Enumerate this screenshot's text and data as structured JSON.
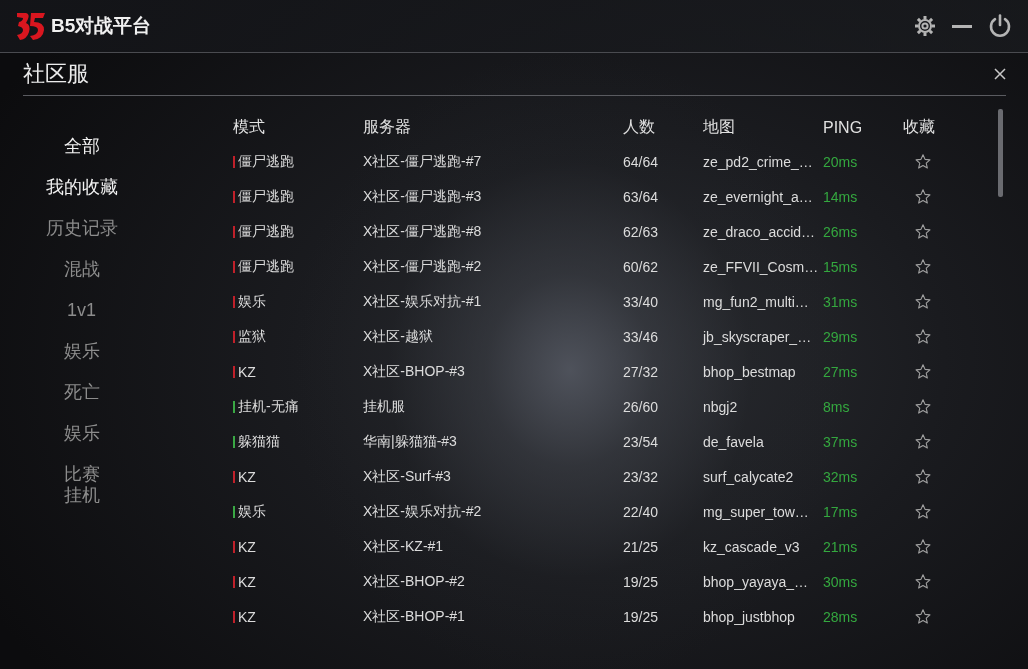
{
  "app": {
    "logo_text": "B5对战平台"
  },
  "panel": {
    "title": "社区服"
  },
  "sidebar": {
    "items": [
      {
        "label": "全部",
        "selected": true
      },
      {
        "label": "我的收藏",
        "selected": true
      },
      {
        "label": "历史记录",
        "selected": false
      },
      {
        "label": "混战",
        "selected": false
      },
      {
        "label": "1v1",
        "selected": false
      },
      {
        "label": "娱乐",
        "selected": false
      },
      {
        "label": "死亡",
        "selected": false
      },
      {
        "label": "娱乐",
        "selected": false
      },
      {
        "label": "比赛挂机",
        "selected": false
      }
    ]
  },
  "table": {
    "columns": [
      "模式",
      "服务器",
      "人数",
      "地图",
      "PING",
      "收藏"
    ],
    "rows": [
      {
        "mode": "僵尸逃跑",
        "color": "#c0202a",
        "server": "X社区-僵尸逃跑-#7",
        "players": "64/64",
        "map": "ze_pd2_crime_…",
        "ping": "20ms",
        "favorited": false
      },
      {
        "mode": "僵尸逃跑",
        "color": "#c0202a",
        "server": "X社区-僵尸逃跑-#3",
        "players": "63/64",
        "map": "ze_evernight_a…",
        "ping": "14ms",
        "favorited": false
      },
      {
        "mode": "僵尸逃跑",
        "color": "#c0202a",
        "server": "X社区-僵尸逃跑-#8",
        "players": "62/63",
        "map": "ze_draco_accid…",
        "ping": "26ms",
        "favorited": false
      },
      {
        "mode": "僵尸逃跑",
        "color": "#c0202a",
        "server": "X社区-僵尸逃跑-#2",
        "players": "60/62",
        "map": "ze_FFVII_Cosm…",
        "ping": "15ms",
        "favorited": false
      },
      {
        "mode": "娱乐",
        "color": "#c0202a",
        "server": "X社区-娱乐对抗-#1",
        "players": "33/40",
        "map": "mg_fun2_multi…",
        "ping": "31ms",
        "favorited": false
      },
      {
        "mode": "监狱",
        "color": "#c0202a",
        "server": "X社区-越狱",
        "players": "33/46",
        "map": "jb_skyscraper_…",
        "ping": "29ms",
        "favorited": false
      },
      {
        "mode": "KZ",
        "color": "#c0202a",
        "server": "X社区-BHOP-#3",
        "players": "27/32",
        "map": "bhop_bestmap",
        "ping": "27ms",
        "favorited": false
      },
      {
        "mode": "挂机-无痛",
        "color": "#3aa844",
        "server": "挂机服",
        "players": "26/60",
        "map": "nbgj2",
        "ping": "8ms",
        "favorited": false
      },
      {
        "mode": "躲猫猫",
        "color": "#3aa844",
        "server": "华南|躲猫猫-#3",
        "players": "23/54",
        "map": "de_favela",
        "ping": "37ms",
        "favorited": false
      },
      {
        "mode": "KZ",
        "color": "#c0202a",
        "server": "X社区-Surf-#3",
        "players": "23/32",
        "map": "surf_calycate2",
        "ping": "32ms",
        "favorited": false
      },
      {
        "mode": "娱乐",
        "color": "#3aa844",
        "server": "X社区-娱乐对抗-#2",
        "players": "22/40",
        "map": "mg_super_tow…",
        "ping": "17ms",
        "favorited": false
      },
      {
        "mode": "KZ",
        "color": "#c0202a",
        "server": "X社区-KZ-#1",
        "players": "21/25",
        "map": "kz_cascade_v3",
        "ping": "21ms",
        "favorited": false
      },
      {
        "mode": "KZ",
        "color": "#c0202a",
        "server": "X社区-BHOP-#2",
        "players": "19/25",
        "map": "bhop_yayaya_…",
        "ping": "30ms",
        "favorited": false
      },
      {
        "mode": "KZ",
        "color": "#c0202a",
        "server": "X社区-BHOP-#1",
        "players": "19/25",
        "map": "bhop_justbhop",
        "ping": "28ms",
        "favorited": false
      }
    ]
  }
}
